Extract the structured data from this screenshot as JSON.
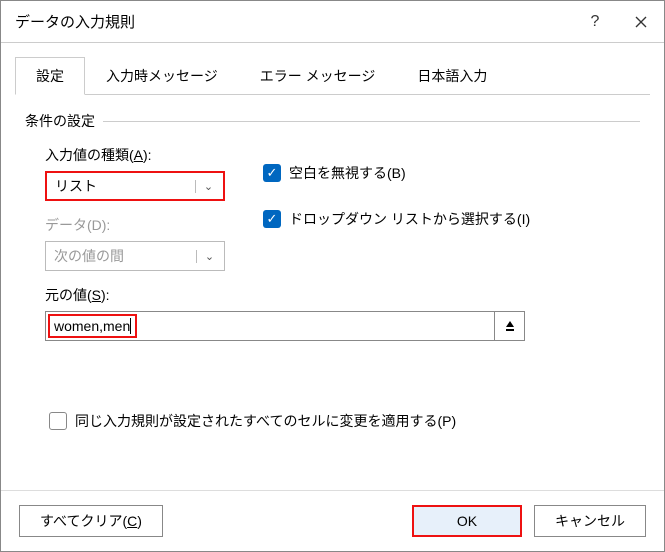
{
  "title": "データの入力規則",
  "tabs": {
    "settings": "設定",
    "input_message": "入力時メッセージ",
    "error_message": "エラー メッセージ",
    "ime": "日本語入力"
  },
  "section": "条件の設定",
  "allow": {
    "label_pre": "入力値の種類(",
    "label_key": "A",
    "label_post": "):",
    "value": "リスト"
  },
  "data": {
    "label": "データ(D):",
    "value": "次の値の間"
  },
  "ignore_blank": {
    "label_pre": "空白を無視する(",
    "label_key": "B",
    "label_post": ")"
  },
  "dropdown": {
    "label_pre": "ドロップダウン リストから選択する(",
    "label_key": "I",
    "label_post": ")"
  },
  "source": {
    "label_pre": "元の値(",
    "label_key": "S",
    "label_post": "):",
    "value": "women,men"
  },
  "apply_all": "同じ入力規則が設定されたすべてのセルに変更を適用する(P)",
  "buttons": {
    "clear_pre": "すべてクリア(",
    "clear_key": "C",
    "clear_post": ")",
    "ok": "OK",
    "cancel": "キャンセル"
  }
}
